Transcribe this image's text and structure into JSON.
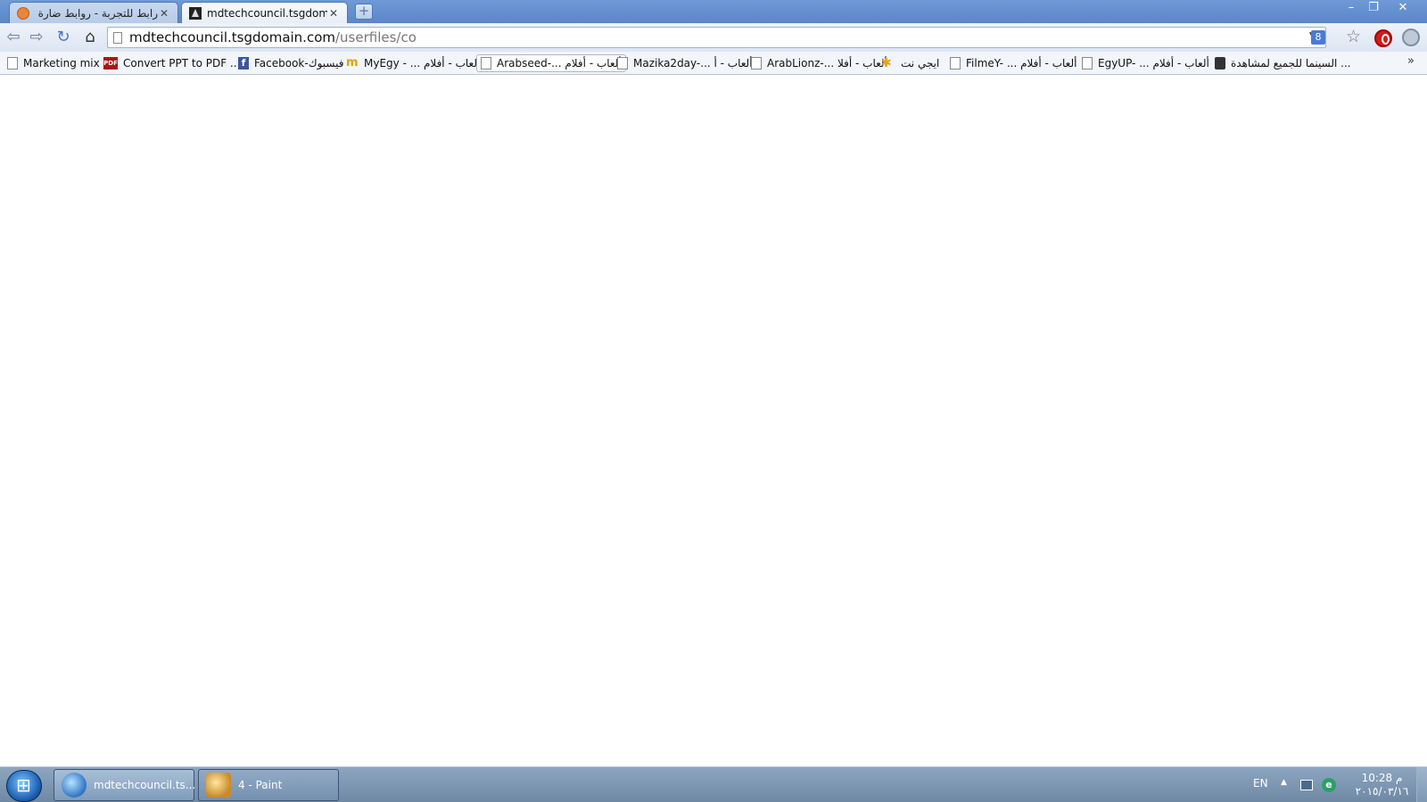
{
  "browser": {
    "tabs": [
      {
        "title": "رابط للتجربة - روابط ضارة ..."
      },
      {
        "title": "mdtechcouncil.tsgdomain"
      }
    ],
    "url_host": "mdtechcouncil.tsgdomain.com",
    "url_path": "/userfiles/co",
    "search_engine_badge": "8"
  },
  "bookmarks": [
    {
      "label": "Marketing mix",
      "icon": "page-icon"
    },
    {
      "label": "Convert PPT to PDF ...",
      "icon": "pdf-icon"
    },
    {
      "label": "Facebook-فيسبوك",
      "icon": "facebook-icon"
    },
    {
      "label": "MyEgy - ... ألعاب - أفلام",
      "icon": "myegy-icon"
    },
    {
      "label": "Arabseed-... ألعاب - أفلام",
      "icon": "page-icon"
    },
    {
      "label": "Mazika2day-... ألعاب - أ",
      "icon": "page-icon"
    },
    {
      "label": "ArabLionz-... ألعاب - أفلا",
      "icon": "page-icon"
    },
    {
      "label": "ايجي نت",
      "icon": "egynet-icon"
    },
    {
      "label": "FilmeY- ... ألعاب - أفلام",
      "icon": "page-icon"
    },
    {
      "label": "EgyUP- ... ألعاب - أفلام",
      "icon": "page-icon"
    },
    {
      "label": "السينما للجميع لمشاهدة ...",
      "icon": "camera-icon"
    }
  ],
  "bookmarks_overflow": "»",
  "taskbar": {
    "tasks": [
      {
        "label": "mdtechcouncil.ts...",
        "icon": "browser-globe-icon"
      },
      {
        "label": "4 - Paint",
        "icon": "paint-icon"
      }
    ],
    "language": "EN",
    "clock_time": "10:28 م",
    "clock_date": "٢٠١٥/٠٣/١٦"
  },
  "colors": {
    "titlebar": "#5a86c9",
    "taskbar": "#7f98b4",
    "content_background": "#ffffff"
  }
}
